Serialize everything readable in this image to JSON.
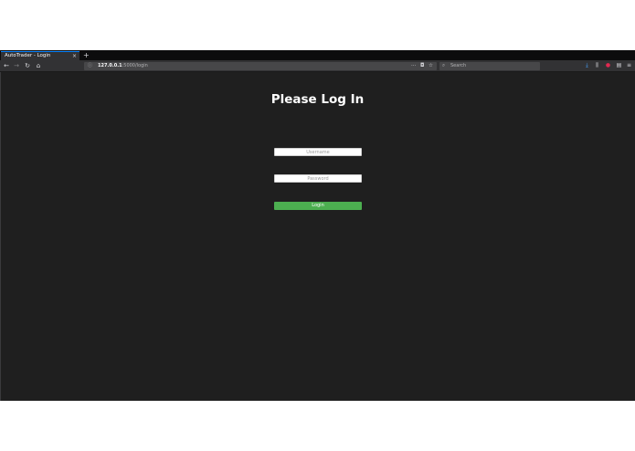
{
  "browser": {
    "tab": {
      "title": "AutoTrader - Login",
      "close": "×"
    },
    "new_tab": "+",
    "nav": {
      "back": "←",
      "forward": "→",
      "reload": "↻",
      "home": "⌂"
    },
    "url": {
      "info": "ⓘ",
      "host": "127.0.0.1",
      "path": ":5000/login"
    },
    "url_actions": {
      "more": "···",
      "pocket": "◘",
      "bookmark": "☆"
    },
    "search": {
      "icon": "⌕",
      "placeholder": "Search"
    },
    "toolbar": {
      "download": "⤓",
      "library": "⫼",
      "extension": "●",
      "sidebar": "▤",
      "menu": "≡"
    }
  },
  "page": {
    "title": "Please Log In",
    "username_placeholder": "Username",
    "password_placeholder": "Password",
    "login_label": "Login"
  },
  "colors": {
    "background": "#1f1f1f",
    "login_button": "#4caf50",
    "tab_accent": "#0a84ff"
  }
}
